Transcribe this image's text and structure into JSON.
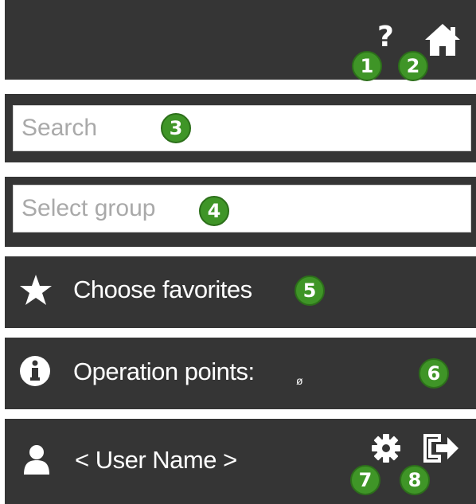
{
  "header": {
    "help_glyph": "?",
    "icons": [
      "question-icon",
      "home-icon"
    ]
  },
  "search": {
    "placeholder": "Search"
  },
  "group_select": {
    "placeholder": "Select group"
  },
  "favorites": {
    "label": "Choose favorites",
    "icon": "star-icon"
  },
  "operation_points": {
    "label": "Operation points:",
    "value": "ø",
    "icon": "info-icon"
  },
  "user": {
    "name": "< User Name >",
    "icons": [
      "user-icon",
      "gear-icon",
      "logout-icon"
    ]
  },
  "callouts": [
    "1",
    "2",
    "3",
    "4",
    "5",
    "6",
    "7",
    "8"
  ],
  "colors": {
    "panel_bg": "#353535",
    "badge_green": "#3f9527",
    "text": "#ffffff",
    "placeholder": "#a9a9a9"
  }
}
